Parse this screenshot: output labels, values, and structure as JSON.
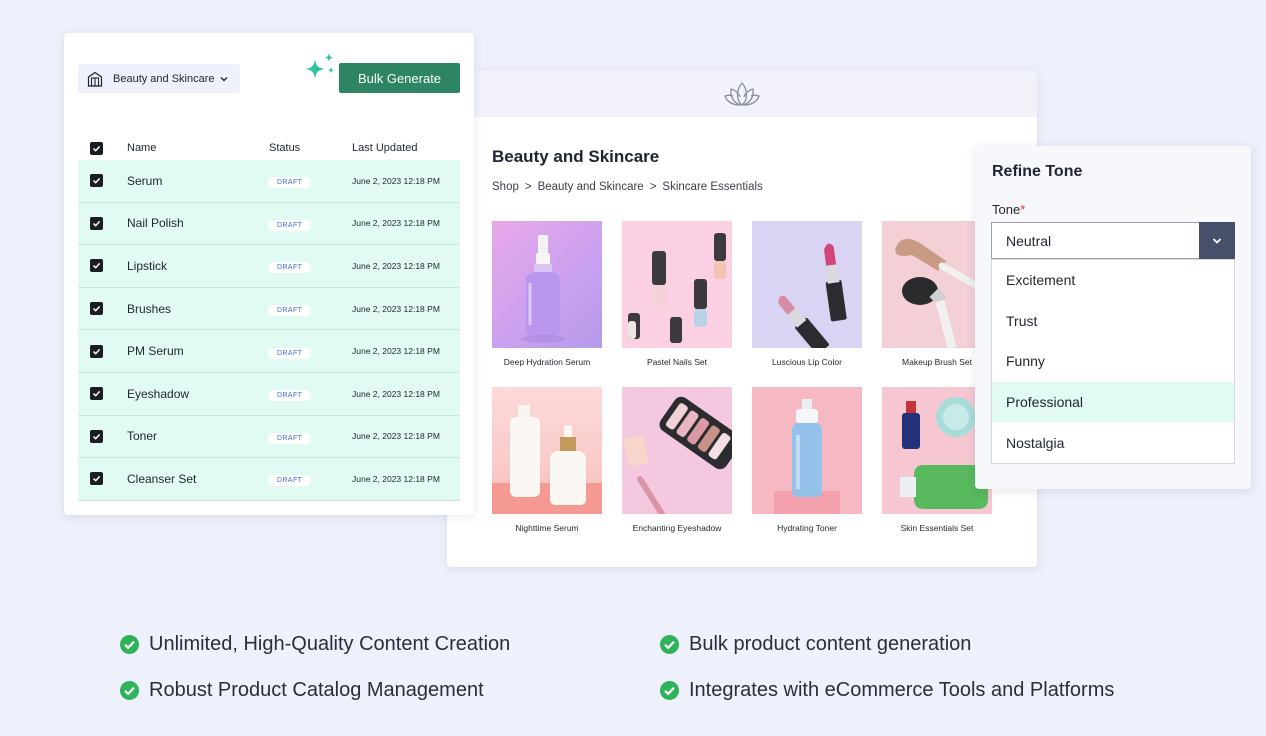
{
  "table": {
    "category_select": "Beauty and Skincare",
    "bulk_button": "Bulk Generate",
    "columns": {
      "name": "Name",
      "status": "Status",
      "updated": "Last Updated"
    },
    "rows": [
      {
        "name": "Serum",
        "status": "DRAFT",
        "updated": "June 2, 2023  12:18 PM"
      },
      {
        "name": "Nail Polish",
        "status": "DRAFT",
        "updated": "June 2, 2023  12:18 PM"
      },
      {
        "name": "Lipstick",
        "status": "DRAFT",
        "updated": "June 2, 2023  12:18 PM"
      },
      {
        "name": "Brushes",
        "status": "DRAFT",
        "updated": "June 2, 2023  12:18 PM"
      },
      {
        "name": "PM Serum",
        "status": "DRAFT",
        "updated": "June 2, 2023  12:18 PM"
      },
      {
        "name": "Eyeshadow",
        "status": "DRAFT",
        "updated": "June 2, 2023  12:18 PM"
      },
      {
        "name": "Toner",
        "status": "DRAFT",
        "updated": "June 2, 2023  12:18 PM"
      },
      {
        "name": "Cleanser Set",
        "status": "DRAFT",
        "updated": "June 2, 2023  12:18 PM"
      }
    ],
    "accent_color": "#2e8564",
    "row_color": "#e1faf3"
  },
  "shop": {
    "logo_icon": "lotus-icon",
    "title": "Beauty and Skincare",
    "breadcrumb": [
      "Shop",
      ">",
      "Beauty and Skincare",
      ">",
      "Skincare Essentials"
    ],
    "products": [
      {
        "name": "Deep Hydration Serum"
      },
      {
        "name": "Pastel Nails Set"
      },
      {
        "name": "Luscious Lip Color"
      },
      {
        "name": "Makeup Brush Set"
      },
      {
        "name": "Nighttime Serum"
      },
      {
        "name": "Enchanting Eyeshadow"
      },
      {
        "name": "Hydrating Toner"
      },
      {
        "name": "Skin Essentials Set"
      }
    ]
  },
  "tone": {
    "title": "Refine Tone",
    "label": "Tone",
    "required_mark": "*",
    "selected": "Neutral",
    "options": [
      "Excitement",
      "Trust",
      "Funny",
      "Professional",
      "Nostalgia"
    ],
    "highlighted_option": "Professional"
  },
  "features": [
    "Unlimited, High-Quality Content Creation",
    "Bulk product content generation",
    "Robust Product Catalog Management",
    "Integrates with eCommerce Tools and Platforms"
  ]
}
